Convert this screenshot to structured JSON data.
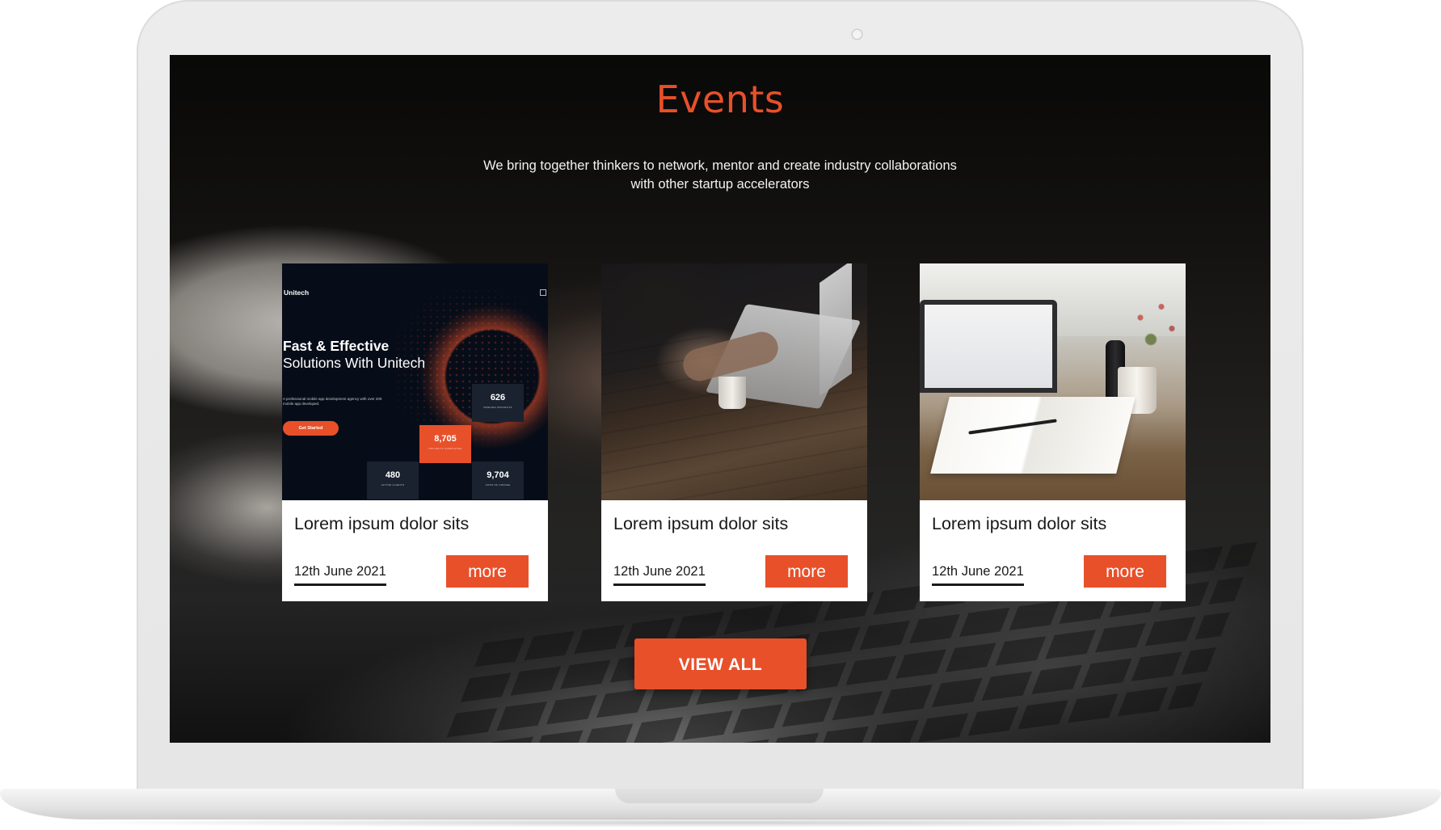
{
  "section": {
    "title": "Events",
    "subtitle": "We bring together thinkers to network, mentor and create industry collaborations with other startup accelerators"
  },
  "events": [
    {
      "title": "Lorem ipsum dolor sits",
      "date": "12th June 2021",
      "more_label": "more",
      "image": {
        "kind": "website-screenshot",
        "brand": "Unitech",
        "headline_bold": "Fast & Effective",
        "headline_rest": "Solutions With Unitech",
        "body": "A professional mobile app development agency with over 200 mobile app developed.",
        "cta": "Get Started",
        "stats": [
          {
            "value": "626",
            "label": "PENDING PROJECTS"
          },
          {
            "value": "8,705",
            "label": "PROJECTS COMPLETED"
          },
          {
            "value": "480",
            "label": "ACTIVE CLIENTS"
          },
          {
            "value": "9,704",
            "label": "CUPS OF COFFEE"
          }
        ]
      }
    },
    {
      "title": "Lorem ipsum dolor sits",
      "date": "12th June 2021",
      "more_label": "more",
      "image": {
        "kind": "photo-person-laptop-coffee"
      }
    },
    {
      "title": "Lorem ipsum dolor sits",
      "date": "12th June 2021",
      "more_label": "more",
      "image": {
        "kind": "photo-laptop-notebook-mug"
      }
    }
  ],
  "view_all_label": "VIEW ALL",
  "colors": {
    "accent": "#e8502a",
    "card_bg": "#ffffff",
    "text_dark": "#1a1a1a",
    "subtitle_text": "#f2f2f2",
    "bezel": "#e8e8e8"
  }
}
